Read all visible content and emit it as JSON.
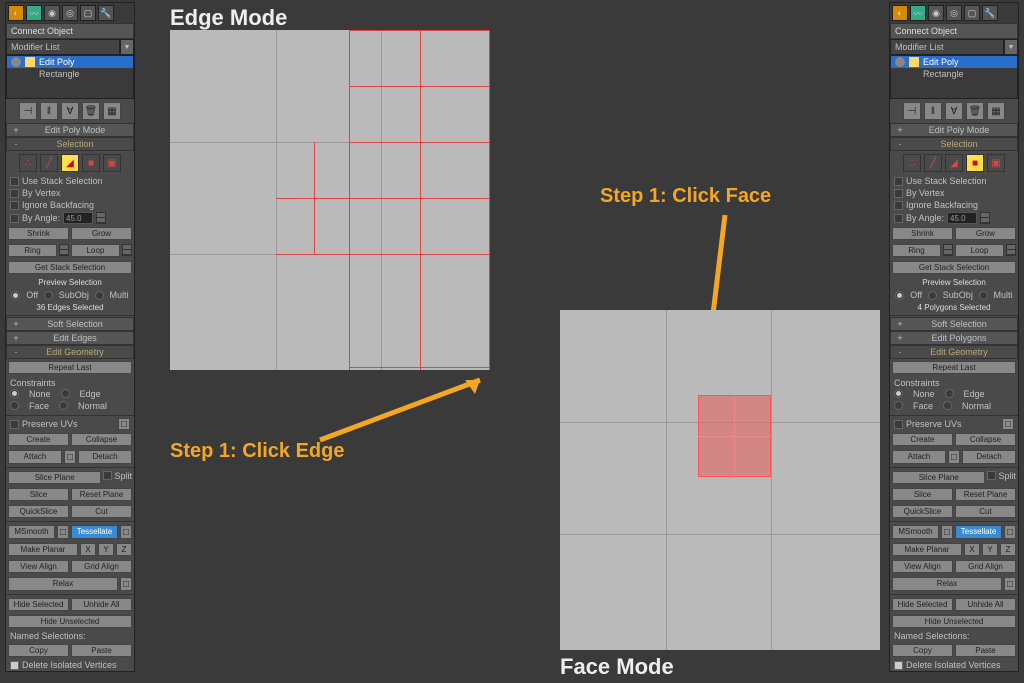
{
  "titles": {
    "edge_mode": "Edge Mode",
    "face_mode": "Face Mode"
  },
  "steps": {
    "click_edge": "Step 1: Click Edge",
    "click_face": "Step 1: Click Face"
  },
  "panel": {
    "connect_object": "Connect Object",
    "modifier_list": "Modifier List",
    "stack": {
      "edit_poly": "Edit Poly",
      "rectangle": "Rectangle"
    },
    "edit_poly_mode": "Edit Poly Mode",
    "selection": "Selection",
    "use_stack_selection": "Use Stack Selection",
    "by_vertex": "By Vertex",
    "ignore_backfacing": "Ignore Backfacing",
    "by_angle": "By Angle:",
    "angle_val": "45.0",
    "shrink": "Shrink",
    "grow": "Grow",
    "ring": "Ring",
    "loop": "Loop",
    "get_stack_selection": "Get Stack Selection",
    "preview_selection": "Preview Selection",
    "off": "Off",
    "subobj": "SubObj",
    "multi": "Multi",
    "edges_selected": "36 Edges Selected",
    "polys_selected": "4 Polygons Selected",
    "soft_selection": "Soft Selection",
    "edit_edges": "Edit Edges",
    "edit_polygons": "Edit Polygons",
    "edit_geometry": "Edit Geometry",
    "repeat_last": "Repeat Last",
    "constraints": "Constraints",
    "none": "None",
    "edge": "Edge",
    "face": "Face",
    "normal": "Normal",
    "preserve_uvs": "Preserve UVs",
    "create": "Create",
    "collapse": "Collapse",
    "attach": "Attach",
    "detach": "Detach",
    "slice_plane": "Slice Plane",
    "split": "Split",
    "slice": "Slice",
    "reset_plane": "Reset Plane",
    "quickslice": "QuickSlice",
    "cut": "Cut",
    "msmooth": "MSmooth",
    "tessellate": "Tessellate",
    "make_planar": "Make Planar",
    "x": "X",
    "y": "Y",
    "z": "Z",
    "view_align": "View Align",
    "grid_align": "Grid Align",
    "relax": "Relax",
    "hide_selected": "Hide Selected",
    "unhide_all": "Unhide All",
    "hide_unselected": "Hide Unselected",
    "named_selections": "Named Selections:",
    "copy": "Copy",
    "paste": "Paste",
    "delete_isolated": "Delete Isolated Vertices"
  }
}
